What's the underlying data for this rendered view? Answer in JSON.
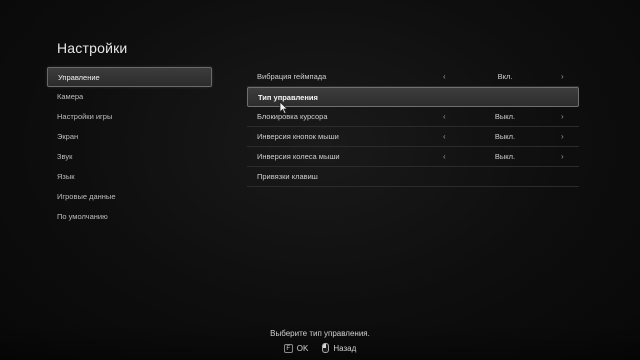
{
  "page_title": "Настройки",
  "sidebar": {
    "items": [
      {
        "label": "Управление",
        "active": true
      },
      {
        "label": "Камера",
        "active": false
      },
      {
        "label": "Настройки игры",
        "active": false
      },
      {
        "label": "Экран",
        "active": false
      },
      {
        "label": "Звук",
        "active": false
      },
      {
        "label": "Язык",
        "active": false
      },
      {
        "label": "Игровые данные",
        "active": false
      },
      {
        "label": "По умолчанию",
        "active": false
      }
    ]
  },
  "options": {
    "rows": [
      {
        "label": "Вибрация геймпада",
        "value": "Вкл.",
        "left_arrow": "‹",
        "right_arrow": "›"
      },
      {
        "label": "Тип управления",
        "value": "",
        "left_arrow": "",
        "right_arrow": ""
      },
      {
        "label": "Блокировка курсора",
        "value": "Выкл.",
        "left_arrow": "‹",
        "right_arrow": "›"
      },
      {
        "label": "Инверсия кнопок мыши",
        "value": "Выкл.",
        "left_arrow": "‹",
        "right_arrow": "›"
      },
      {
        "label": "Инверсия колеса мыши",
        "value": "Выкл.",
        "left_arrow": "‹",
        "right_arrow": "›"
      },
      {
        "label": "Привязки клавиш",
        "value": "",
        "left_arrow": "",
        "right_arrow": ""
      }
    ]
  },
  "footer": {
    "hint": "Выберите тип управления.",
    "ok_key": "F",
    "ok_label": "OK",
    "back_label": "Назад"
  },
  "colors": {
    "background": "#0b0b0b",
    "highlight": "#3c3c3c",
    "highlight_border": "#707070",
    "text": "#d8d8d8"
  }
}
